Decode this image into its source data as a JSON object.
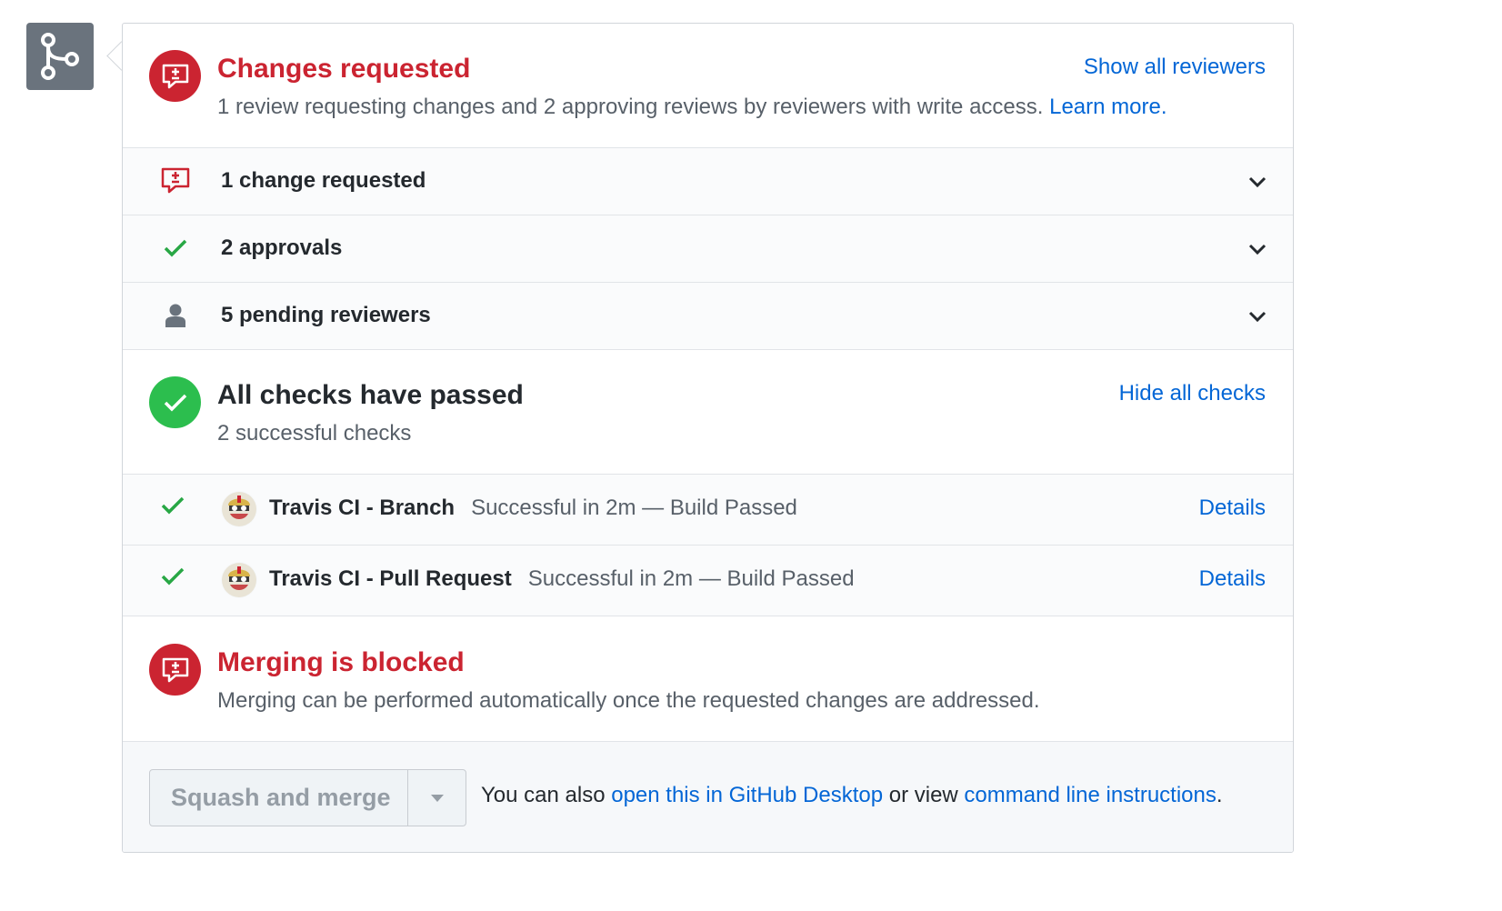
{
  "review": {
    "title": "Changes requested",
    "subtitle": "1 review requesting changes and 2 approving reviews by reviewers with write access.",
    "learn_more": "Learn more.",
    "show_all": "Show all reviewers",
    "rows": [
      {
        "icon": "comment-diff-icon",
        "label": "1 change requested"
      },
      {
        "icon": "check-icon",
        "label": "2 approvals"
      },
      {
        "icon": "person-icon",
        "label": "5 pending reviewers"
      }
    ]
  },
  "checks": {
    "title": "All checks have passed",
    "subtitle": "2 successful checks",
    "hide_all": "Hide all checks",
    "items": [
      {
        "name": "Travis CI - Branch",
        "desc": "Successful in 2m — Build Passed",
        "details": "Details"
      },
      {
        "name": "Travis CI - Pull Request",
        "desc": "Successful in 2m — Build Passed",
        "details": "Details"
      }
    ]
  },
  "merge": {
    "title": "Merging is blocked",
    "subtitle": "Merging can be performed automatically once the requested changes are addressed.",
    "button_label": "Squash and merge",
    "footer_prefix": "You can also ",
    "footer_link1": "open this in GitHub Desktop",
    "footer_middle": " or view ",
    "footer_link2": "command line instructions",
    "footer_suffix": "."
  },
  "colors": {
    "red": "#cb2431",
    "green": "#2cbe4e",
    "link": "#0366d6",
    "gray": "#6a737d"
  }
}
